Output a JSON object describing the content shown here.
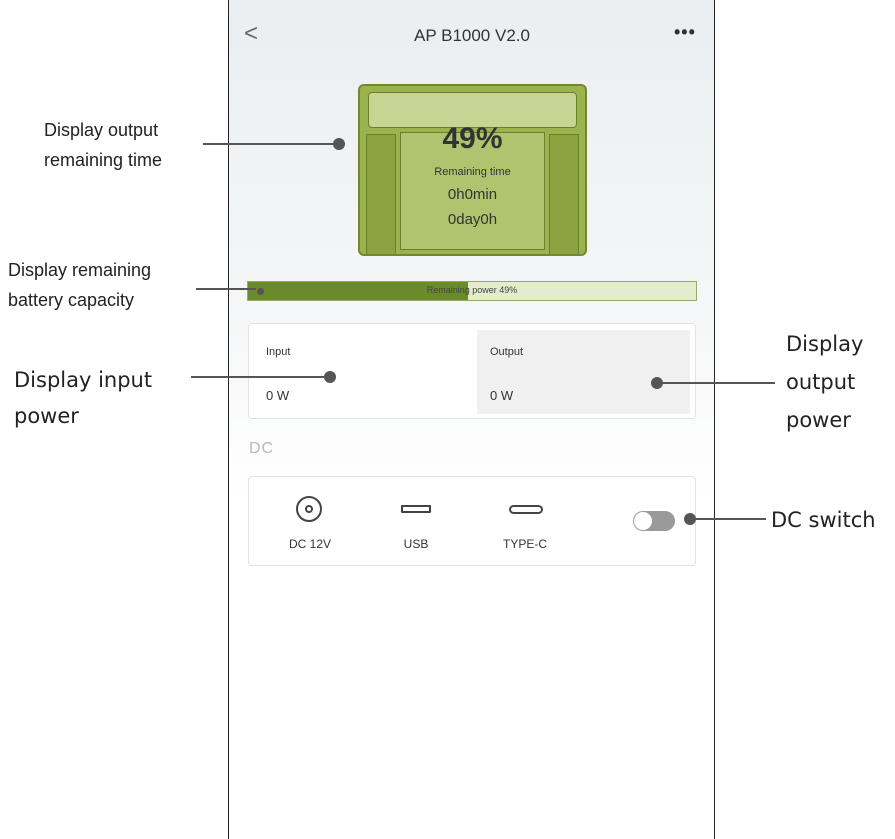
{
  "app": {
    "title": "AP B1000 V2.0",
    "back_symbol": "<",
    "more_symbol": "•••"
  },
  "battery": {
    "percent": "49%",
    "percent_value": 49,
    "remaining_label": "Remaining time",
    "time_line1": "0h0min",
    "time_line2": "0day0h",
    "color": "#9bb34f"
  },
  "progress": {
    "label": "Remaining power 49%",
    "fill_percent": 49,
    "fill_color": "#6b8a2b"
  },
  "power": {
    "input_label": "Input",
    "input_value": "0 W",
    "output_label": "Output",
    "output_value": "0 W"
  },
  "dc": {
    "section_title": "DC",
    "ports": [
      {
        "label": "DC 12V",
        "icon": "dc-12v-port-icon"
      },
      {
        "label": "USB",
        "icon": "usb-port-icon"
      },
      {
        "label": "TYPE-C",
        "icon": "type-c-port-icon"
      }
    ],
    "switch_on": false
  },
  "annotations": {
    "remaining_time_1": "Display output",
    "remaining_time_2": "remaining time",
    "battery_capacity_1": "Display remaining",
    "battery_capacity_2": "battery capacity",
    "input_power_1": "Display input",
    "input_power_2": "power",
    "output_power_1": "Display",
    "output_power_2": "output",
    "output_power_3": "power",
    "dc_switch": "DC switch"
  }
}
